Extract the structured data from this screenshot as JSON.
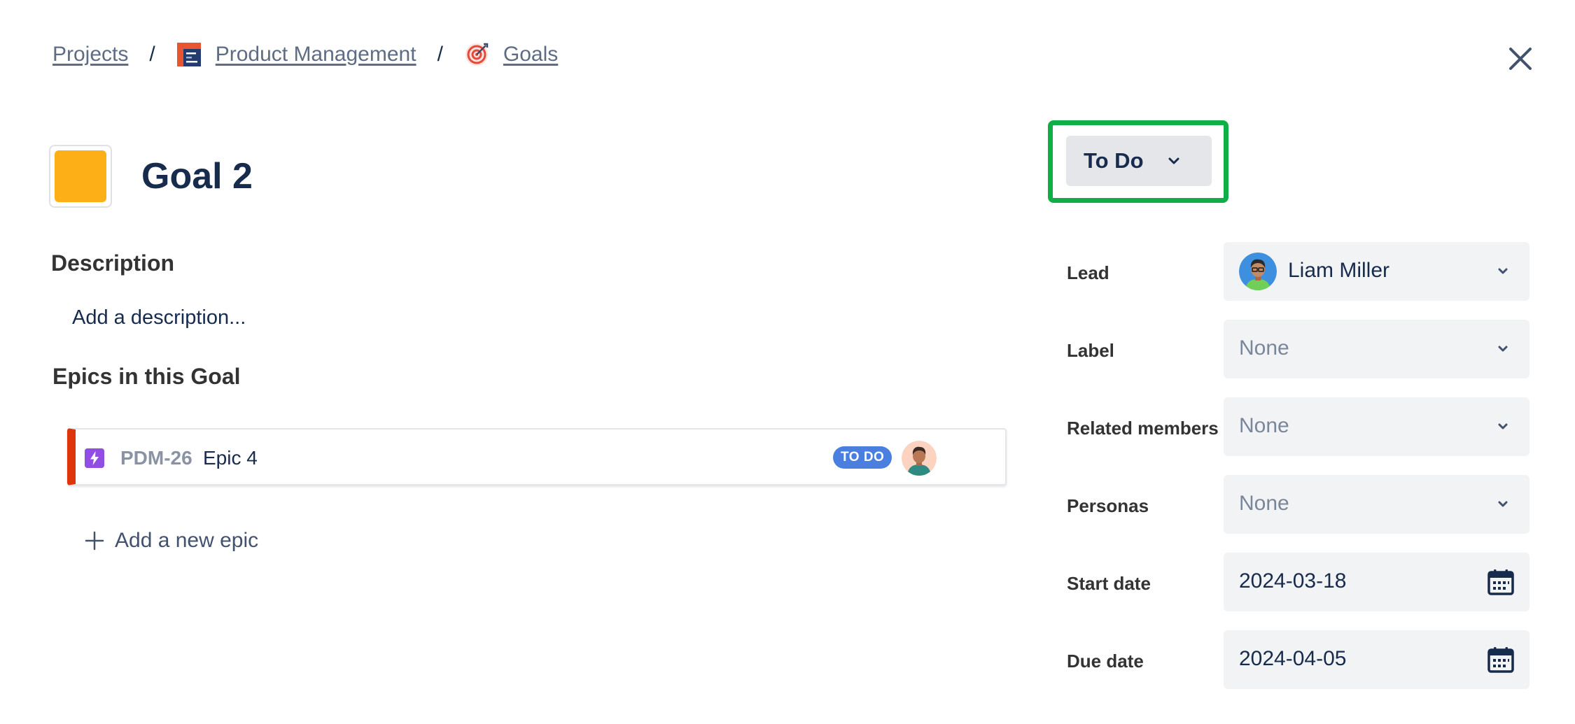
{
  "breadcrumb": {
    "projects": "Projects",
    "separator": "/",
    "project": "Product Management",
    "section": "Goals"
  },
  "goal": {
    "title": "Goal 2",
    "color": "#fcaf17"
  },
  "description": {
    "heading": "Description",
    "placeholder": "Add a description..."
  },
  "epics": {
    "heading": "Epics in this Goal",
    "items": [
      {
        "key": "PDM-26",
        "name": "Epic 4",
        "status": "TO DO",
        "status_color": "#4a7fe0",
        "stripe_color": "#de350b"
      }
    ],
    "add_label": "Add a new epic"
  },
  "status": {
    "value": "To Do",
    "highlight_color": "#0fae47"
  },
  "fields": {
    "lead": {
      "label": "Lead",
      "value": "Liam Miller"
    },
    "label": {
      "label": "Label",
      "value": "None"
    },
    "related_members": {
      "label": "Related members",
      "value": "None"
    },
    "personas": {
      "label": "Personas",
      "value": "None"
    },
    "start_date": {
      "label": "Start date",
      "value": "2024-03-18"
    },
    "due_date": {
      "label": "Due date",
      "value": "2024-04-05"
    }
  },
  "icons": {
    "project": "product-management-icon",
    "goals": "target-icon",
    "close": "close-icon",
    "epic_type": "lightning-icon",
    "dropdown": "chevron-down-icon",
    "calendar": "calendar-icon",
    "add": "plus-icon"
  }
}
